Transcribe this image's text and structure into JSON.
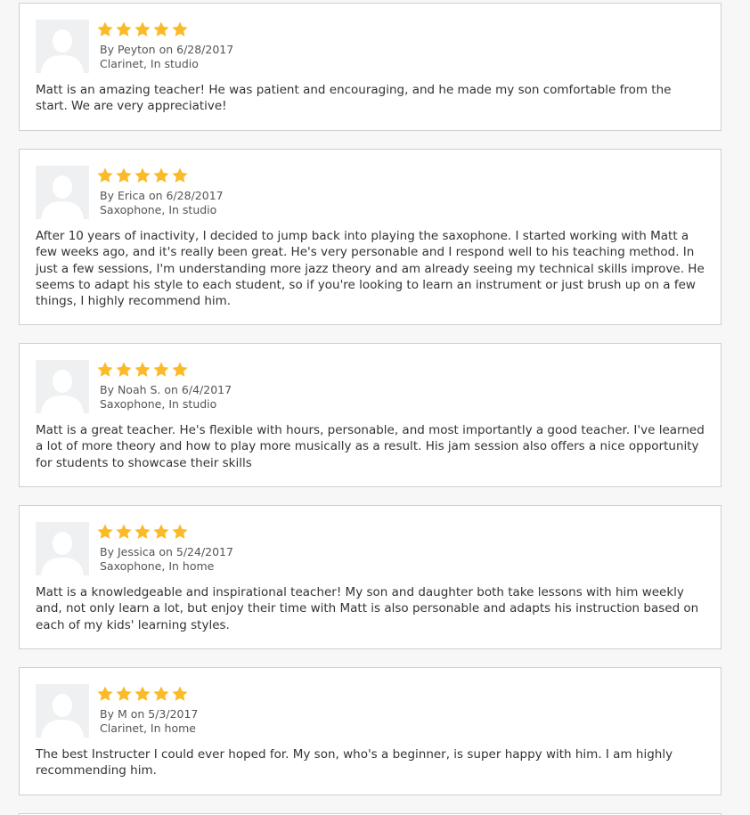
{
  "colors": {
    "star": "#FBBA27",
    "border": "#cfcfcf",
    "avatar_bg": "#eef0f2"
  },
  "icons": {
    "avatar": "user-silhouette-icon",
    "star": "star-icon"
  },
  "reviews": [
    {
      "rating": 5,
      "author_line": "By Peyton on 6/28/2017",
      "detail": "Clarinet, In studio",
      "text": "Matt is an amazing teacher! He was patient and encouraging, and he made my son comfortable from the start. We are very appreciative!"
    },
    {
      "rating": 5,
      "author_line": "By Erica on 6/28/2017",
      "detail": "Saxophone, In studio",
      "text": "After 10 years of inactivity, I decided to jump back into playing the saxophone. I started working with Matt a few weeks ago, and it's really been great. He's very personable and I respond well to his teaching method. In just a few sessions, I'm understanding more jazz theory and am already seeing my technical skills improve. He seems to adapt his style to each student, so if you're looking to learn an instrument or just brush up on a few things, I highly recommend him."
    },
    {
      "rating": 5,
      "author_line": "By Noah S. on 6/4/2017",
      "detail": "Saxophone, In studio",
      "text": "Matt is a great teacher. He's flexible with hours, personable, and most importantly a good teacher. I've learned a lot of more theory and how to play more musically as a result. His jam session also offers a nice opportunity for students to showcase their skills"
    },
    {
      "rating": 5,
      "author_line": "By Jessica on 5/24/2017",
      "detail": "Saxophone, In home",
      "text": "Matt is a knowledgeable and inspirational teacher! My son and daughter both take lessons with him weekly and, not only learn a lot, but enjoy their time with Matt is also personable and adapts his instruction based on each of my kids' learning styles."
    },
    {
      "rating": 5,
      "author_line": "By M on 5/3/2017",
      "detail": "Clarinet, In home",
      "text": "The best Instructer I could ever hoped for. My son, who's a beginner, is super happy with him. I am highly recommending him."
    },
    {
      "rating": null,
      "author_line": "",
      "detail": "",
      "text": ""
    }
  ]
}
